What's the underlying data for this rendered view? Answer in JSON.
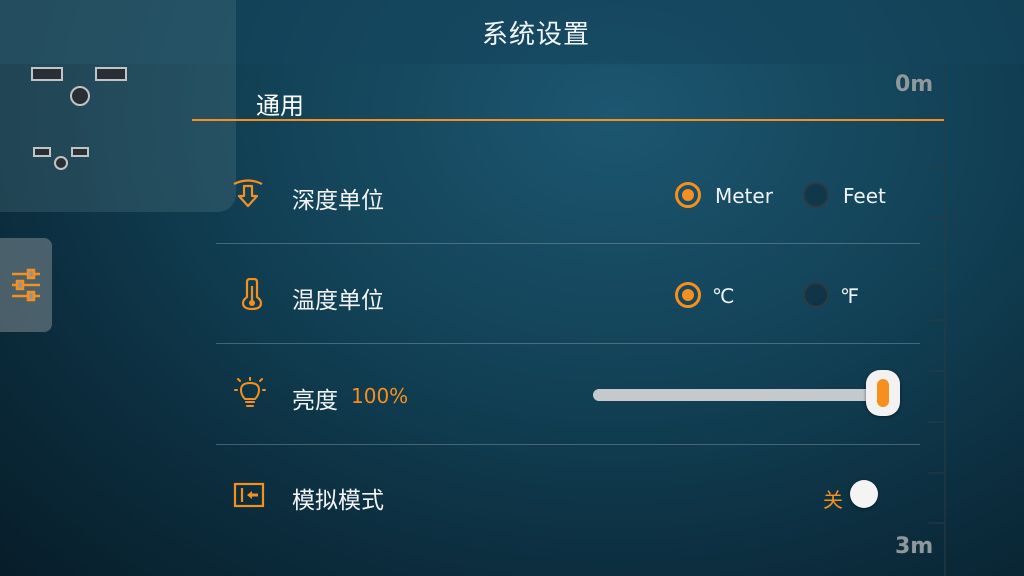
{
  "header": {
    "title": "系统设置"
  },
  "scale": {
    "top_label": "0m",
    "bottom_label": "3m"
  },
  "section": {
    "title": "通用"
  },
  "rows": {
    "depth_unit": {
      "icon": "depth-arrow-icon",
      "label": "深度单位",
      "options": [
        {
          "label": "Meter",
          "selected": true
        },
        {
          "label": "Feet",
          "selected": false
        }
      ]
    },
    "temperature_unit": {
      "icon": "thermometer-icon",
      "label": "温度单位",
      "options": [
        {
          "label": "℃",
          "selected": true
        },
        {
          "label": "℉",
          "selected": false
        }
      ]
    },
    "brightness": {
      "icon": "lightbulb-icon",
      "label": "亮度",
      "value_text": "100%",
      "level": 1.0
    },
    "simulation_mode": {
      "icon": "simulation-icon",
      "label": "模拟模式",
      "state_text": "关",
      "enabled": false
    }
  },
  "colors": {
    "accent": "#f5901e",
    "background": "#0f3a4e"
  }
}
